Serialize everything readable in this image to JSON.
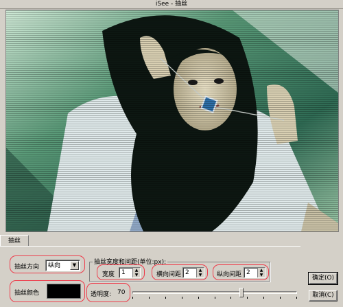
{
  "window": {
    "title": "iSee - 抽丝"
  },
  "tabs": [
    {
      "label": "抽丝"
    }
  ],
  "direction": {
    "label": "抽丝方向",
    "selected": "纵向"
  },
  "color": {
    "label": "抽丝颜色",
    "value": "#000000"
  },
  "size_group": {
    "title": "抽丝宽度和间距(单位:px):",
    "width": {
      "label": "宽度",
      "value": "1"
    },
    "h_spacing": {
      "label": "横向间距",
      "value": "2"
    },
    "v_spacing": {
      "label": "纵向间距",
      "value": "2"
    }
  },
  "opacity": {
    "label": "透明度:",
    "value": "70",
    "fraction": 0.7
  },
  "buttons": {
    "ok": "确定(O)",
    "cancel": "取消(C)"
  },
  "colors": {
    "highlight": "#ee3b4a",
    "dialog_bg": "#d4d0c8"
  }
}
